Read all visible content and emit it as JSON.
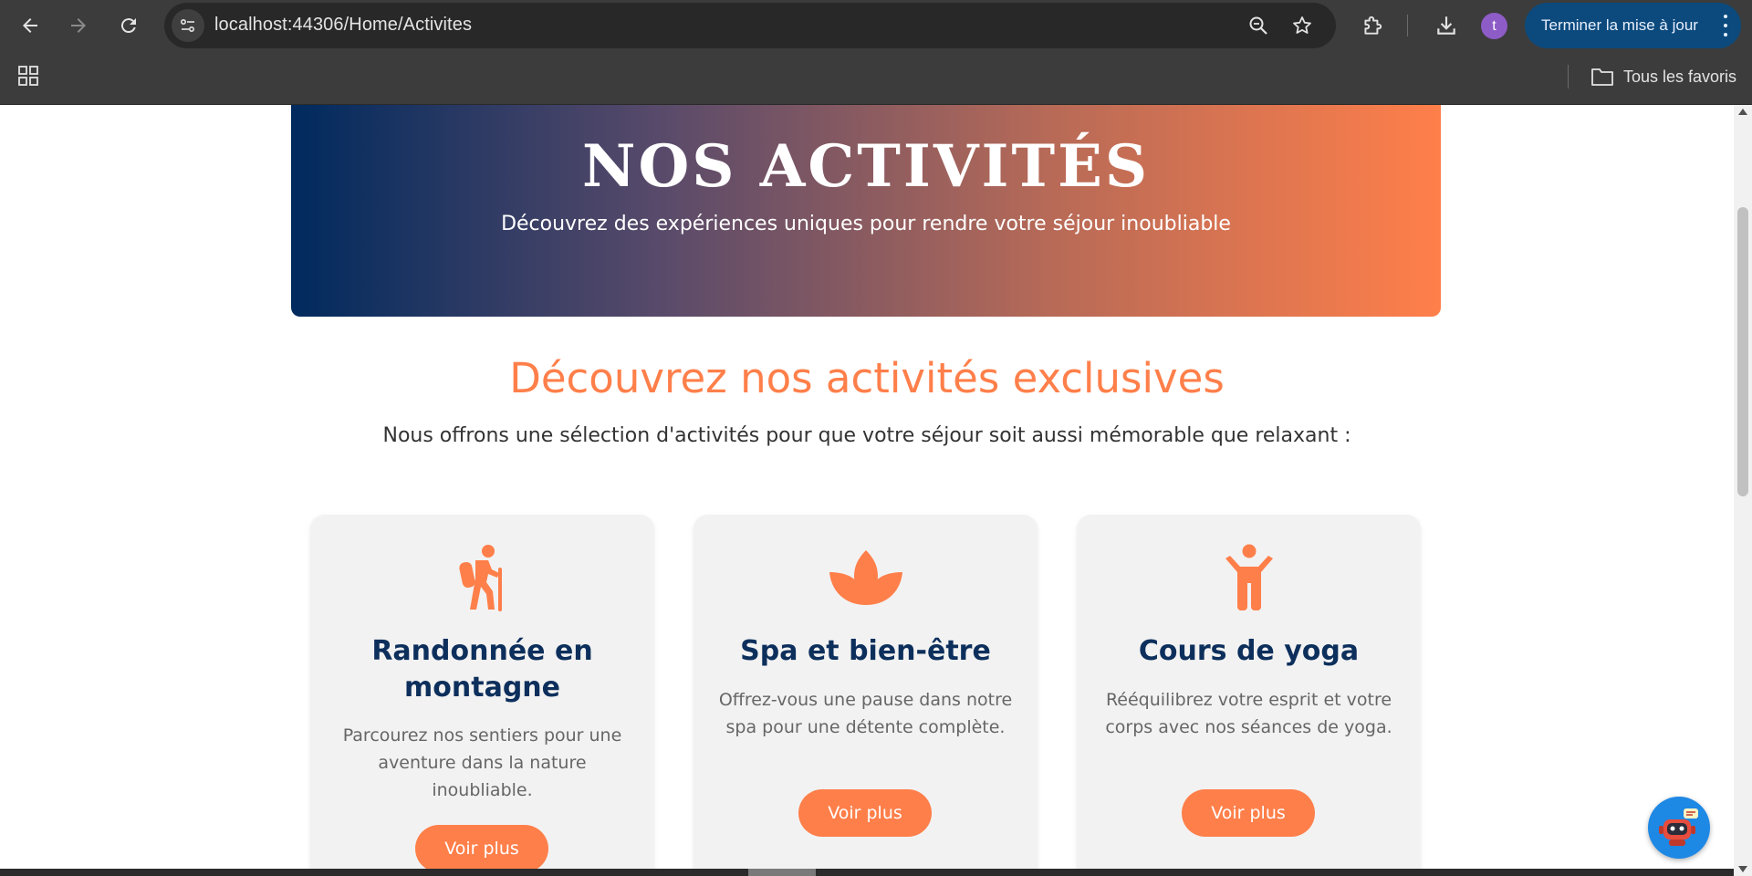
{
  "browser": {
    "url_host": "localhost",
    "url_rest": ":44306/Home/Activites",
    "avatar_letter": "t",
    "update_label": "Terminer la mise à jour",
    "bookmarks_folder": "Tous les favoris",
    "icons": [
      "back-icon",
      "forward-icon",
      "reload-icon",
      "site-info-icon",
      "zoom-icon",
      "star-icon",
      "extensions-icon",
      "download-icon",
      "apps-icon",
      "folder-icon"
    ]
  },
  "hero": {
    "title": "NOS ACTIVITÉS",
    "subtitle": "Découvrez des expériences uniques pour rendre votre séjour inoubliable"
  },
  "section": {
    "title": "Découvrez nos activités exclusives",
    "intro": "Nous offrons une sélection d'activités pour que votre séjour soit aussi mémorable que relaxant :"
  },
  "cards": [
    {
      "icon": "hiking-icon",
      "title": "Randonnée en montagne",
      "description": "Parcourez nos sentiers pour une aventure dans la nature inoubliable.",
      "button": "Voir plus"
    },
    {
      "icon": "spa-icon",
      "title": "Spa et bien-être",
      "description": "Offrez-vous une pause dans notre spa pour une détente complète.",
      "button": "Voir plus"
    },
    {
      "icon": "yoga-icon",
      "title": "Cours de yoga",
      "description": "Rééquilibrez votre esprit et votre corps avec nos séances de yoga.",
      "button": "Voir plus"
    }
  ],
  "colors": {
    "accent": "#ff7f4a",
    "navy": "#0d2f5c",
    "gradient_start": "#002a5e",
    "gradient_end": "#ff7f4a"
  }
}
